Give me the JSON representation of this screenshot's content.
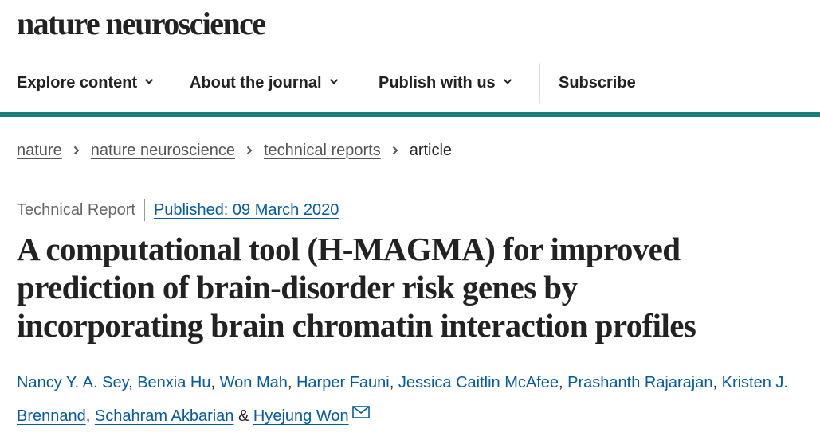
{
  "masthead": {
    "logo": "nature neuroscience"
  },
  "nav": {
    "items": [
      {
        "label": "Explore content",
        "icon": "chevron-down-icon"
      },
      {
        "label": "About the journal",
        "icon": "chevron-down-icon"
      },
      {
        "label": "Publish with us",
        "icon": "chevron-down-icon"
      }
    ],
    "subscribe": "Subscribe"
  },
  "colors": {
    "accent_bar": "#1b7f79",
    "link": "#045ba3",
    "text": "#222222"
  },
  "breadcrumb": {
    "items": [
      "nature",
      "nature neuroscience",
      "technical reports"
    ],
    "current": "article",
    "separator_icon": "chevron-right-icon"
  },
  "article": {
    "type": "Technical Report",
    "published": "Published: 09 March 2020",
    "title_lines": [
      "A computational tool (H-MAGMA) for improved",
      "prediction of brain-disorder risk genes by",
      "incorporating brain chromatin interaction profiles"
    ],
    "authors": [
      "Nancy Y. A. Sey",
      "Benxia Hu",
      "Won Mah",
      "Harper Fauni",
      "Jessica Caitlin McAfee",
      "Prashanth Rajarajan",
      "Kristen J. Brennand",
      "Schahram Akbarian",
      "Hyejung Won"
    ],
    "author_separator": ",",
    "author_conjunction": "&",
    "contact_icon": "mail-icon"
  }
}
